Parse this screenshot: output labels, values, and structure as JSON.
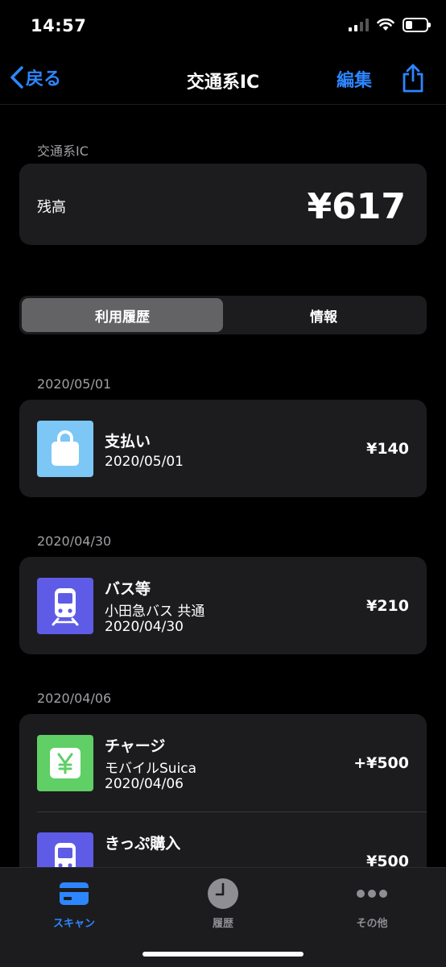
{
  "status": {
    "time": "14:57"
  },
  "nav": {
    "back_label": "戻る",
    "title": "交通系IC",
    "edit_label": "編集"
  },
  "card": {
    "section_title": "交通系IC",
    "balance_label": "残高",
    "balance_value": "¥617"
  },
  "segments": {
    "items": [
      "利用履歴",
      "情報"
    ],
    "selected": "利用履歴"
  },
  "transactions": [
    {
      "date_header": "2020/05/01",
      "entries": [
        {
          "title": "支払い",
          "lines": [
            "2020/05/01"
          ],
          "amount": "¥140",
          "icon": "shopping-bag-icon",
          "color": "#7cc7f5"
        }
      ]
    },
    {
      "date_header": "2020/04/30",
      "entries": [
        {
          "title": "バス等",
          "lines": [
            "小田急バス 共通",
            "2020/04/30"
          ],
          "amount": "¥210",
          "icon": "train-icon",
          "color": "#5e5ce6"
        }
      ]
    },
    {
      "date_header": "2020/04/06",
      "entries": [
        {
          "title": "チャージ",
          "lines": [
            "モバイルSuica",
            "2020/04/06"
          ],
          "amount": "+¥500",
          "icon": "yen-icon",
          "color": "#5fcf66"
        },
        {
          "title": "きっぷ購入",
          "lines": [],
          "amount": "¥500",
          "icon": "train-icon",
          "color": "#5e5ce6"
        }
      ]
    }
  ],
  "tabs": [
    {
      "label": "スキャン",
      "icon": "card-icon",
      "active": true
    },
    {
      "label": "履歴",
      "icon": "clock-icon",
      "active": false
    },
    {
      "label": "その他",
      "icon": "more-icon",
      "active": false
    }
  ],
  "colors": {
    "accent": "#2d86ff",
    "background": "#000000",
    "card": "#1c1c1e"
  }
}
